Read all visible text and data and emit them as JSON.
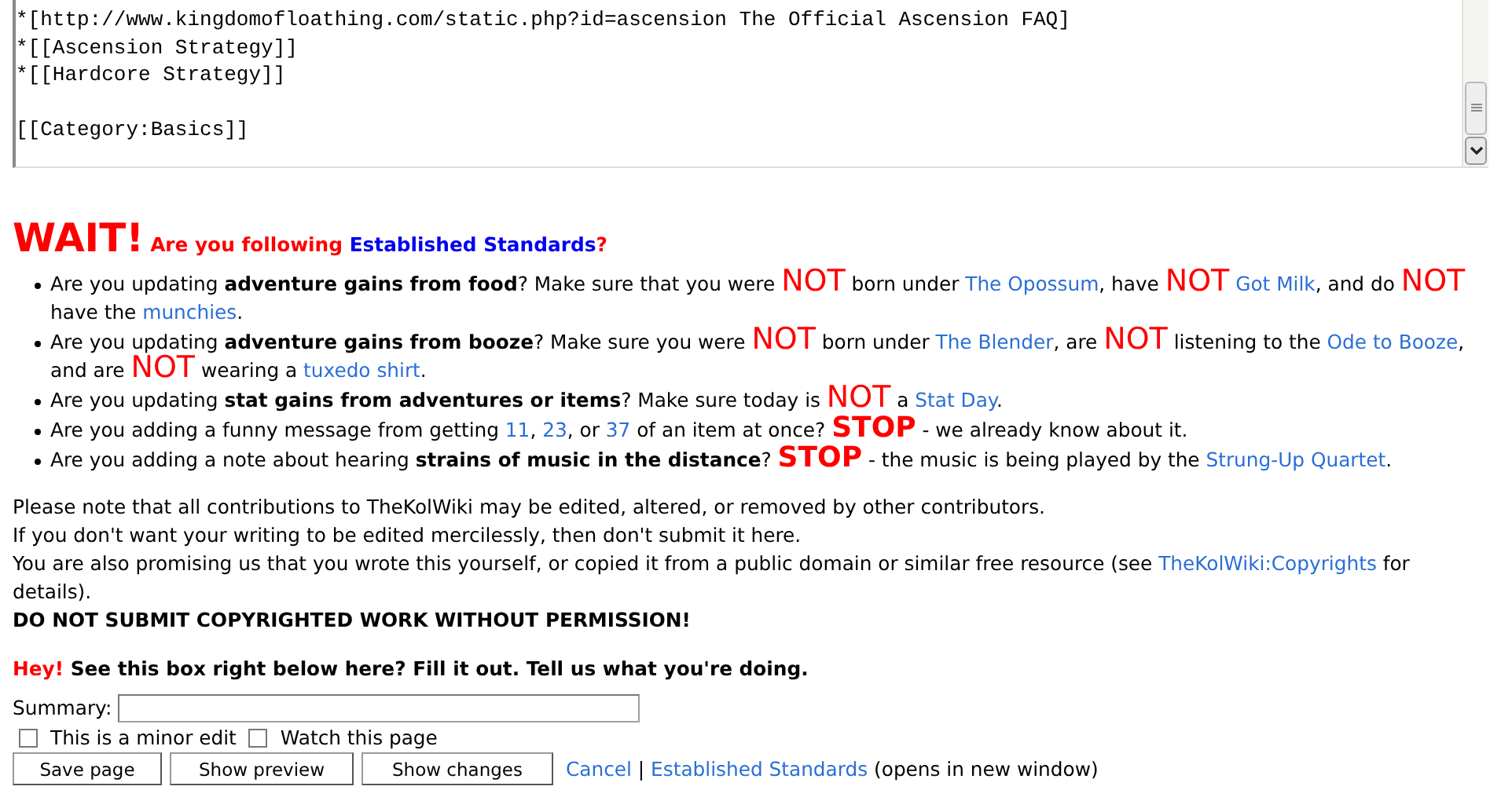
{
  "editor": {
    "lines": [
      {
        "kind": "code",
        "text": "*[http://www.kingdomofloathing.com/static.php?id=ascension The Official Ascension FAQ]"
      },
      {
        "kind": "code",
        "text": "*[[Ascension Strategy]]"
      },
      {
        "kind": "code",
        "text": "*[[Hardcore Strategy]]"
      },
      {
        "kind": "blank"
      },
      {
        "kind": "code",
        "text": "[[Category:Basics]]"
      }
    ]
  },
  "warning": {
    "title": "WAIT!",
    "question": [
      {
        "kind": "text",
        "text": "Are you following "
      },
      {
        "kind": "link",
        "text": "Established Standards"
      },
      {
        "kind": "text",
        "text": "?"
      }
    ]
  },
  "bullets": [
    [
      {
        "kind": "text",
        "text": "Are you updating "
      },
      {
        "kind": "bold",
        "text": "adventure gains from food"
      },
      {
        "kind": "text",
        "text": "? Make sure that you were "
      },
      {
        "kind": "not",
        "text": "NOT"
      },
      {
        "kind": "text",
        "text": " born under "
      },
      {
        "kind": "link",
        "text": "The Opossum"
      },
      {
        "kind": "text",
        "text": ", have "
      },
      {
        "kind": "not",
        "text": "NOT"
      },
      {
        "kind": "space"
      },
      {
        "kind": "link",
        "text": "Got Milk"
      },
      {
        "kind": "text",
        "text": ", and do "
      },
      {
        "kind": "not",
        "text": "NOT"
      },
      {
        "kind": "text",
        "text": " have the "
      },
      {
        "kind": "link",
        "text": "munchies"
      },
      {
        "kind": "text",
        "text": "."
      }
    ],
    [
      {
        "kind": "text",
        "text": "Are you updating "
      },
      {
        "kind": "bold",
        "text": "adventure gains from booze"
      },
      {
        "kind": "text",
        "text": "? Make sure you were "
      },
      {
        "kind": "not",
        "text": "NOT"
      },
      {
        "kind": "text",
        "text": " born under "
      },
      {
        "kind": "link",
        "text": "The Blender"
      },
      {
        "kind": "text",
        "text": ", are "
      },
      {
        "kind": "not",
        "text": "NOT"
      },
      {
        "kind": "text",
        "text": " listening to the "
      },
      {
        "kind": "link",
        "text": "Ode to Booze"
      },
      {
        "kind": "text",
        "text": ", and are "
      },
      {
        "kind": "not",
        "text": "NOT"
      },
      {
        "kind": "text",
        "text": " wearing a "
      },
      {
        "kind": "link",
        "text": "tuxedo shirt"
      },
      {
        "kind": "text",
        "text": "."
      }
    ],
    [
      {
        "kind": "text",
        "text": "Are you updating "
      },
      {
        "kind": "bold",
        "text": "stat gains from adventures or items"
      },
      {
        "kind": "text",
        "text": "? Make sure today is "
      },
      {
        "kind": "not",
        "text": "NOT"
      },
      {
        "kind": "text",
        "text": " a "
      },
      {
        "kind": "link",
        "text": "Stat Day"
      },
      {
        "kind": "text",
        "text": "."
      }
    ],
    [
      {
        "kind": "text",
        "text": "Are you adding a funny message from getting "
      },
      {
        "kind": "link",
        "text": "11"
      },
      {
        "kind": "text",
        "text": ", "
      },
      {
        "kind": "link",
        "text": "23"
      },
      {
        "kind": "text",
        "text": ", or "
      },
      {
        "kind": "link",
        "text": "37"
      },
      {
        "kind": "text",
        "text": " of an item at once? "
      },
      {
        "kind": "stop",
        "text": "STOP"
      },
      {
        "kind": "text",
        "text": " - we already know about it."
      }
    ],
    [
      {
        "kind": "text",
        "text": "Are you adding a note about hearing "
      },
      {
        "kind": "bold",
        "text": "strains of music in the distance"
      },
      {
        "kind": "text",
        "text": "? "
      },
      {
        "kind": "stop",
        "text": "STOP"
      },
      {
        "kind": "text",
        "text": " - the music is being played by the "
      },
      {
        "kind": "link",
        "text": "Strung-Up Quartet"
      },
      {
        "kind": "text",
        "text": "."
      }
    ]
  ],
  "notice": [
    [
      {
        "kind": "text",
        "text": "Please note that all contributions to TheKolWiki may be edited, altered, or removed by other contributors."
      }
    ],
    [
      {
        "kind": "text",
        "text": "If you don't want your writing to be edited mercilessly, then don't submit it here."
      }
    ],
    [
      {
        "kind": "text",
        "text": "You are also promising us that you wrote this yourself, or copied it from a public domain or similar free resource (see "
      },
      {
        "kind": "link",
        "text": "TheKolWiki:Copyrights"
      },
      {
        "kind": "text",
        "text": " for details)."
      }
    ],
    [
      {
        "kind": "bold",
        "text": "DO NOT SUBMIT COPYRIGHTED WORK WITHOUT PERMISSION!"
      }
    ]
  ],
  "hint": {
    "lead": "Hey!",
    "text": "See this box right below here? Fill it out. Tell us what you're doing."
  },
  "summary": {
    "label": "Summary:"
  },
  "options": [
    {
      "label": "This is a minor edit",
      "checked": false
    },
    {
      "label": "Watch this page",
      "checked": false
    }
  ],
  "buttons": [
    "Save page",
    "Show preview",
    "Show changes"
  ],
  "footer": [
    {
      "kind": "link",
      "text": "Cancel"
    },
    {
      "kind": "text",
      "text": " | "
    },
    {
      "kind": "link",
      "text": "Established Standards"
    },
    {
      "kind": "text",
      "text": " (opens in new window)"
    }
  ]
}
